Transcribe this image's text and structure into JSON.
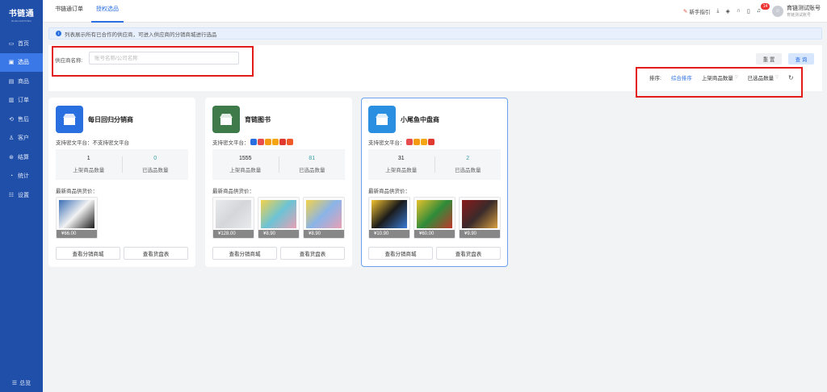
{
  "app": {
    "name": "书链通",
    "sub": "SHULIANTONG"
  },
  "sidebar": {
    "items": [
      {
        "label": "首页",
        "icon": "home-icon",
        "glyph": "▭"
      },
      {
        "label": "选品",
        "icon": "select-icon",
        "glyph": "▣",
        "active": true
      },
      {
        "label": "商品",
        "icon": "goods-icon",
        "glyph": "▤"
      },
      {
        "label": "订单",
        "icon": "order-icon",
        "glyph": "▥"
      },
      {
        "label": "售后",
        "icon": "aftersale-icon",
        "glyph": "⟲"
      },
      {
        "label": "客户",
        "icon": "customer-icon",
        "glyph": "♙"
      },
      {
        "label": "结算",
        "icon": "settlement-icon",
        "glyph": "⊛"
      },
      {
        "label": "统计",
        "icon": "stats-icon",
        "glyph": "◔"
      },
      {
        "label": "设置",
        "icon": "settings-icon",
        "glyph": "☷"
      }
    ],
    "overview": "总览"
  },
  "topbar": {
    "tabs": [
      {
        "label": "书链通订单",
        "active": false
      },
      {
        "label": "授权选品",
        "active": true
      }
    ],
    "guide": "新手指引",
    "notification_count": "14",
    "user_name": "育链测试账号",
    "user_role": "育链测试账号"
  },
  "info": {
    "text": "列表展示所有已合作的供应商，可进入供应商的分销商城进行选品"
  },
  "filter": {
    "supplier_label": "供应商名称:",
    "search_placeholder": "账号名称/公司名称",
    "search_value": "",
    "reset_label": "重 置",
    "query_label": "查 询"
  },
  "sort": {
    "label": "排序:",
    "options": [
      {
        "label": "综合排序",
        "active": true,
        "caret": false
      },
      {
        "label": "上架商品数量",
        "active": false,
        "caret": true
      },
      {
        "label": "已选品数量",
        "active": false,
        "caret": true
      }
    ]
  },
  "cards": [
    {
      "name": "每日回归分销商",
      "logo_color": "#2a6fe0",
      "platform_label": "支持密文平台：",
      "platform_text": "不支持密文平台",
      "platform_icons": [],
      "listed_count": "1",
      "listed_label": "上架商品数量",
      "selected_count": "0",
      "selected_label": "已选品数量",
      "latest_label": "最新商品供货价：",
      "products": [
        {
          "price": "¥66.00",
          "colors": [
            "#3b6fb6",
            "#f2f2f2",
            "#1b1b1b"
          ]
        }
      ],
      "btn_mall": "查看分销商城",
      "btn_sheet": "查看货盘表",
      "selected": false
    },
    {
      "name": "育链图书",
      "logo_color": "#3e7a4a",
      "platform_label": "支持密文平台：",
      "platform_text": "",
      "platform_icons": [
        "#2a6fe0",
        "#e64c4c",
        "#f39c12",
        "#f3a512",
        "#e03a2f",
        "#f05a28"
      ],
      "listed_count": "1555",
      "listed_label": "上架商品数量",
      "selected_count": "81",
      "selected_label": "已选品数量",
      "latest_label": "最新商品供货价：",
      "products": [
        {
          "price": "¥128.00",
          "colors": [
            "#e9eaec",
            "#d4d6da",
            "#e9eaec"
          ]
        },
        {
          "price": "¥8.90",
          "colors": [
            "#f2d24a",
            "#6cc3d5",
            "#e8a0b4"
          ]
        },
        {
          "price": "¥8.90",
          "colors": [
            "#f2d24a",
            "#8ab4e8",
            "#e8a0b4"
          ]
        }
      ],
      "btn_mall": "查看分销商城",
      "btn_sheet": "查看货盘表",
      "selected": false
    },
    {
      "name": "小尾鱼中盘商",
      "logo_color": "#2a8fe0",
      "platform_label": "支持密文平台：",
      "platform_text": "",
      "platform_icons": [
        "#e64c4c",
        "#f39c12",
        "#f3a512",
        "#e03a2f"
      ],
      "listed_count": "31",
      "listed_label": "上架商品数量",
      "selected_count": "2",
      "selected_label": "已选品数量",
      "latest_label": "最新商品供货价：",
      "products": [
        {
          "price": "¥10.90",
          "colors": [
            "#f2c230",
            "#1b1b1b",
            "#3a7bd5"
          ]
        },
        {
          "price": "¥60.00",
          "colors": [
            "#e6c12a",
            "#2f8b3a",
            "#c0392b"
          ]
        },
        {
          "price": "¥9.90",
          "colors": [
            "#8b1a1a",
            "#3a2a2a",
            "#d8a040"
          ]
        }
      ],
      "btn_mall": "查看分销商城",
      "btn_sheet": "查看货盘表",
      "selected": true
    }
  ]
}
